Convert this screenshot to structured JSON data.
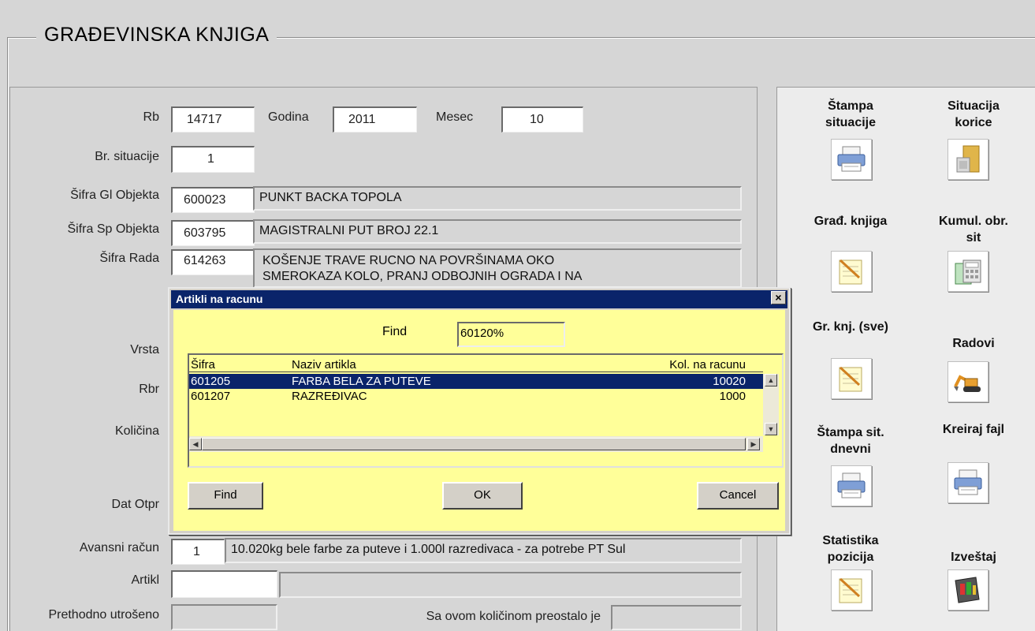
{
  "window": {
    "group_title": "GRAĐEVINSKA KNJIGA"
  },
  "form": {
    "rb_label": "Rb",
    "rb_value": "14717",
    "godina_label": "Godina",
    "godina_value": "2011",
    "mesec_label": "Mesec",
    "mesec_value": "10",
    "br_situacije_label": "Br. situacije",
    "br_situacije_value": "1",
    "sifra_gl_label": "Šifra Gl Objekta",
    "sifra_gl_code": "600023",
    "sifra_gl_name": "PUNKT BACKA TOPOLA",
    "sifra_sp_label": "Šifra Sp Objekta",
    "sifra_sp_code": "603795",
    "sifra_sp_name": "MAGISTRALNI PUT BROJ 22.1",
    "sifra_rada_label": "Šifra Rada",
    "sifra_rada_code": "614263",
    "sifra_rada_name_line1": "KOŠENJE TRAVE RUCNO NA POVRŠINAMA OKO",
    "sifra_rada_name_line2": "SMEROKAZA KOLO, PRANJ ODBOJNIH OGRADA I NA",
    "vrsta_label": "Vrsta",
    "rbr_label": "Rbr",
    "kolicina_label": "Količina",
    "dat_otpr_label": "Dat Otpr",
    "avansni_label": "Avansni račun",
    "avansni_value": "1",
    "avansni_desc": "10.020kg bele farbe za puteve i 1.000l razredivaca - za potrebe PT Sul",
    "artikl_label": "Artikl",
    "prethodno_label": "Prethodno utrošeno",
    "preostalo_label": "Sa ovom količinom preostalo je"
  },
  "tools": [
    {
      "label": "Štampa situacije",
      "icon": "printer-icon"
    },
    {
      "label": "Situacija korice",
      "icon": "folder-icon"
    },
    {
      "label": "Građ. knjiga",
      "icon": "notepad-icon"
    },
    {
      "label": "Kumul. obr. sit",
      "icon": "calculator-icon"
    },
    {
      "label": "Gr. knj. (sve)",
      "icon": "notepad-icon"
    },
    {
      "label": "Radovi",
      "icon": "excavator-icon"
    },
    {
      "label": "Štampa sit. dnevni",
      "icon": "printer-icon"
    },
    {
      "label": "Kreiraj fajl",
      "icon": "printer-icon"
    },
    {
      "label": "Statistika pozicija",
      "icon": "notepad-icon"
    },
    {
      "label": "Izveštaj",
      "icon": "report-icon"
    }
  ],
  "dialog": {
    "title": "Artikli na racunu",
    "close_glyph": "×",
    "find_label": "Find",
    "find_value": "60120%",
    "columns": [
      "Šifra",
      "Naziv artikla",
      "Kol. na racunu"
    ],
    "rows": [
      {
        "sifra": "601205",
        "naziv": "FARBA BELA ZA PUTEVE",
        "kol": "10020",
        "selected": true
      },
      {
        "sifra": "601207",
        "naziv": "RAZREĐIVAC",
        "kol": "1000",
        "selected": false
      }
    ],
    "find_button": "Find",
    "ok_button": "OK",
    "cancel_button": "Cancel"
  },
  "colors": {
    "dialog_bg": "#ffff99",
    "title_bar": "#0a246a",
    "selection": "#0a246a"
  }
}
